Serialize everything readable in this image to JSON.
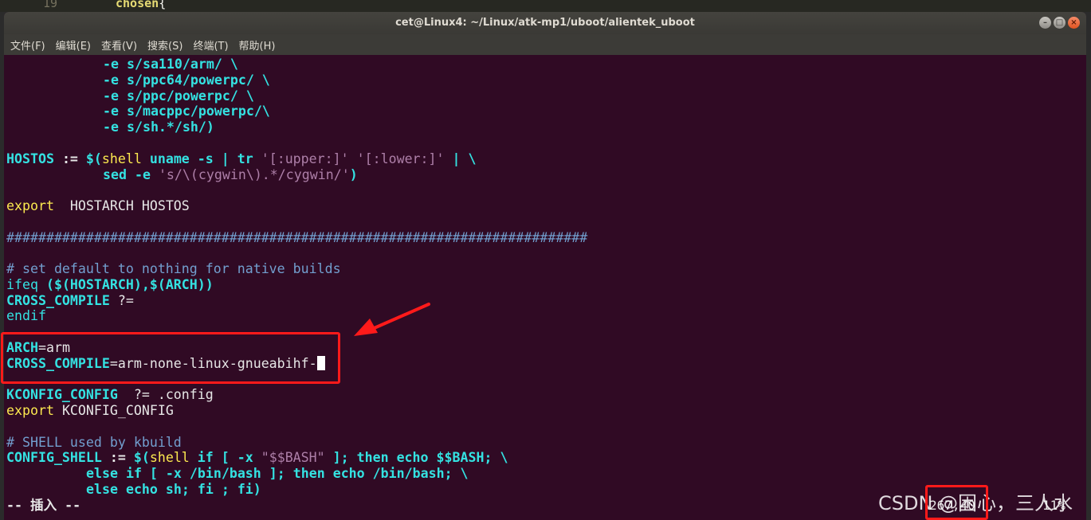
{
  "background_editor": {
    "line_number": "19",
    "code_keyword": "chosen",
    "code_brace": "{"
  },
  "window": {
    "title": "cet@Linux4: ~/Linux/atk-mp1/uboot/alientek_uboot",
    "controls": {
      "minimize": "–",
      "maximize": "□",
      "close": "×"
    }
  },
  "menu": [
    "文件(F)",
    "编辑(E)",
    "查看(V)",
    "搜索(S)",
    "终端(T)",
    "帮助(H)"
  ],
  "terminal": {
    "lines": {
      "l1": "-e s/sa110/arm/ \\",
      "l2": "-e s/ppc64/powerpc/ \\",
      "l3": "-e s/ppc/powerpc/ \\",
      "l4": "-e s/macppc/powerpc/\\",
      "l5": "-e s/sh.*/sh/)",
      "hostos_name": "HOSTOS",
      "hostos_op": " := ",
      "hostos_dollar": "$(",
      "hostos_shell": "shell",
      "hostos_uname": " uname -s | tr ",
      "hostos_s1": "'[:upper:]'",
      "hostos_sp": " ",
      "hostos_s2": "'[:lower:]'",
      "hostos_end": " | \\",
      "sed_cmd": "sed -e ",
      "sed_str": "'s/\\(cygwin\\).*/cygwin/'",
      "sed_close": ")",
      "export_kw": "export",
      "export_vars": "  HOSTARCH HOSTOS",
      "hashes": "#########################################################################",
      "comment1": "# set default to nothing for native builds",
      "ifeq_kw": "ifeq",
      "ifeq_args": " ($(HOSTARCH),$(ARCH))",
      "cc_name": "CROSS_COMPILE",
      "cc_op": " ?=",
      "endif_kw": "endif",
      "arch_name": "ARCH",
      "arch_val": "=arm",
      "cc2_name": "CROSS_COMPILE",
      "cc2_val": "=arm-none-linux-gnueabihf-",
      "kc_name": "KCONFIG_CONFIG",
      "kc_val": "  ?= .config",
      "export2_kw": "export",
      "export2_val": " KCONFIG_CONFIG",
      "comment2": "# SHELL used by kbuild",
      "cs_name": "CONFIG_SHELL",
      "cs_op": " := ",
      "cs_dollar": "$(",
      "cs_shell": "shell",
      "cs_rest1": " if [ -x ",
      "cs_str": "\"$$BASH\"",
      "cs_rest2": " ]; then echo $$BASH; \\",
      "else_if": "else if [ -x /bin/bash ]; then echo /bin/bash; \\",
      "else_echo": "else echo sh; fi ; fi)"
    },
    "mode": "-- 插入 --",
    "cursor_pos": "267,40",
    "scroll_pct": "11%"
  },
  "watermark": "CSDN @困心，三人水",
  "colors": {
    "terminal_bg": "#300a24",
    "cyan": "#34e2e2",
    "yellow": "#fce94f",
    "string": "#ad7fa8",
    "annotation_red": "#ff1a1a"
  }
}
